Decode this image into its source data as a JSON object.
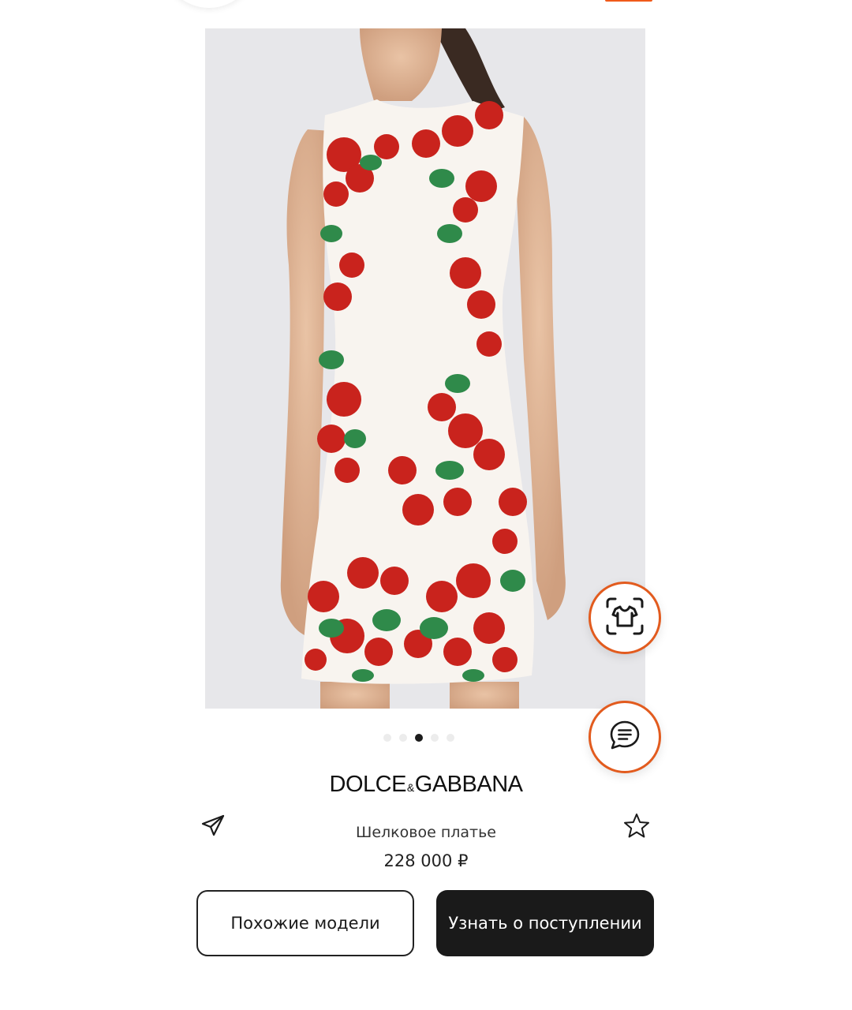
{
  "product": {
    "brand_left": "DOLCE",
    "brand_amp": "&",
    "brand_right": "GABBANA",
    "name": "Шелковое платье",
    "price": "228 000 ₽"
  },
  "gallery": {
    "total_images": 5,
    "active_index": 2
  },
  "actions": {
    "similar_label": "Похожие модели",
    "notify_label": "Узнать о поступлении"
  },
  "icons": {
    "visual_search": "tshirt-scan-icon",
    "chat": "chat-bubble-icon",
    "share": "paper-plane-icon",
    "favorite": "star-outline-icon"
  },
  "colors": {
    "accent": "#e25b1e",
    "primary_button": "#1a1a1a",
    "image_background": "#e7e7ea"
  }
}
